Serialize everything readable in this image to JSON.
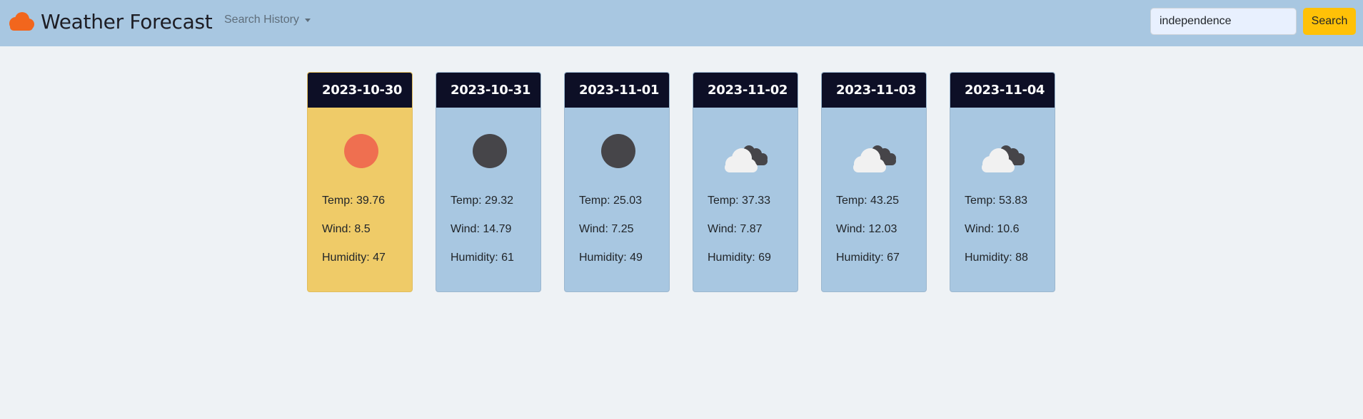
{
  "header": {
    "brand_icon": "cloud-icon",
    "title": "Weather Forecast",
    "history_label": "Search History",
    "search_value": "independence",
    "search_button": "Search"
  },
  "colors": {
    "navbar": "#a8c7e1",
    "background": "#eef2f5",
    "card": "#a8c7e1",
    "today_card": "#efcb68",
    "card_header": "#0d0f26",
    "accent_button": "#ffc107",
    "brand_icon": "#f2661d",
    "sun": "#ef6f50",
    "moon": "#464549",
    "cloud_front": "#f1f1f1",
    "cloud_back": "#464549"
  },
  "forecast": [
    {
      "date": "2023-10-30",
      "icon": "sun-icon",
      "temp": "Temp: 39.76",
      "wind": "Wind: 8.5",
      "humidity": "Humidity: 47"
    },
    {
      "date": "2023-10-31",
      "icon": "moon-icon",
      "temp": "Temp: 29.32",
      "wind": "Wind: 14.79",
      "humidity": "Humidity: 61"
    },
    {
      "date": "2023-11-01",
      "icon": "moon-icon",
      "temp": "Temp: 25.03",
      "wind": "Wind: 7.25",
      "humidity": "Humidity: 49"
    },
    {
      "date": "2023-11-02",
      "icon": "clouds-icon",
      "temp": "Temp: 37.33",
      "wind": "Wind: 7.87",
      "humidity": "Humidity: 69"
    },
    {
      "date": "2023-11-03",
      "icon": "clouds-icon",
      "temp": "Temp: 43.25",
      "wind": "Wind: 12.03",
      "humidity": "Humidity: 67"
    },
    {
      "date": "2023-11-04",
      "icon": "clouds-icon",
      "temp": "Temp: 53.83",
      "wind": "Wind: 10.6",
      "humidity": "Humidity: 88"
    }
  ]
}
